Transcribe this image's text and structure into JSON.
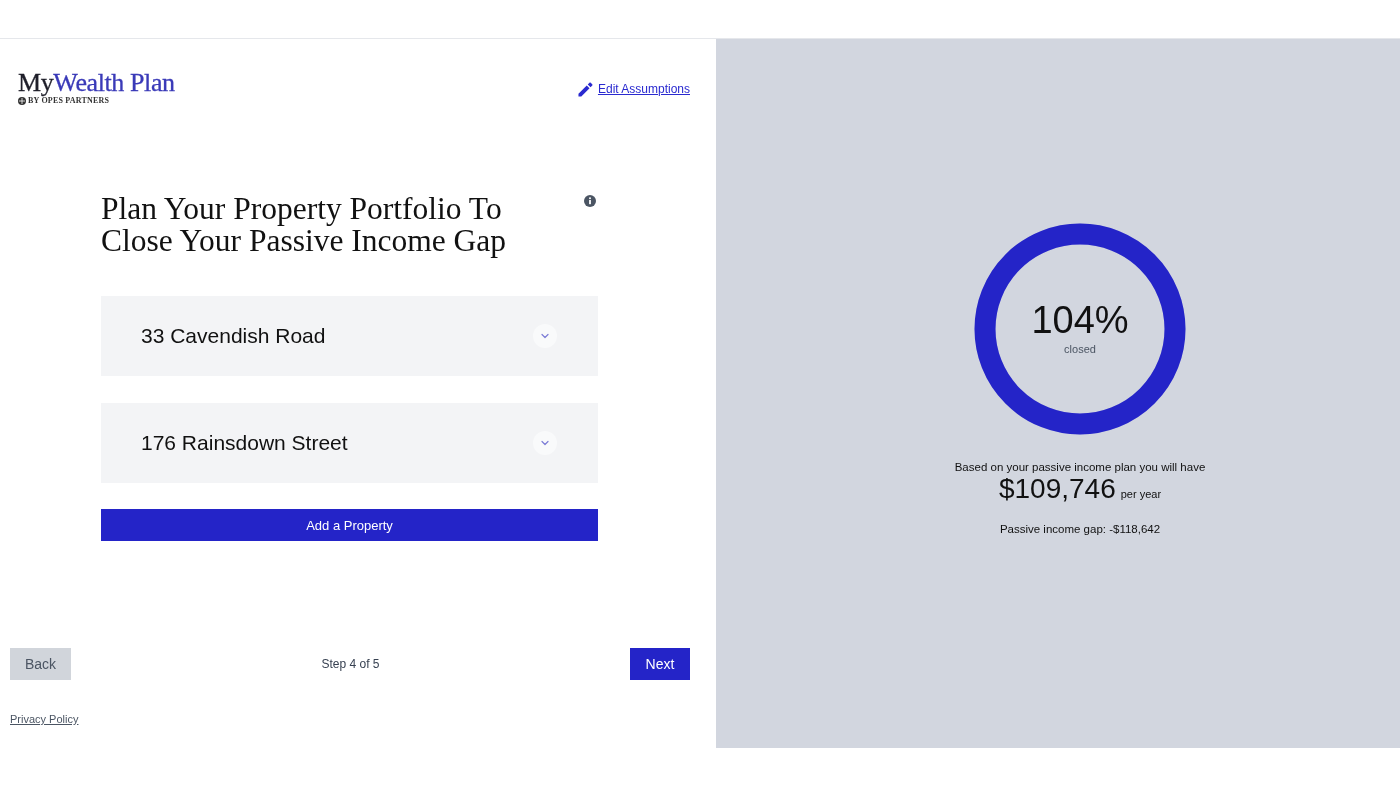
{
  "logo": {
    "prefix": "My",
    "name": "Wealth Plan",
    "tagline": "BY OPES PARTNERS"
  },
  "edit_link": "Edit Assumptions",
  "heading": "Plan Your Property Portfolio To Close Your Passive Income Gap",
  "properties": [
    {
      "address": "33 Cavendish Road",
      "expanded": false
    },
    {
      "address": "176 Rainsdown Street",
      "expanded": false
    }
  ],
  "add_button": "Add a Property",
  "navigation": {
    "back": "Back",
    "step": "Step 4 of 5",
    "next": "Next"
  },
  "privacy_link": "Privacy Policy",
  "summary": {
    "percent": "104%",
    "percent_caption": "closed",
    "level": 1,
    "intro": "Based on your passive income plan you will have",
    "amount": "$109,746",
    "amount_unit": "per year",
    "gap": "Passive income gap: -$118,642"
  }
}
